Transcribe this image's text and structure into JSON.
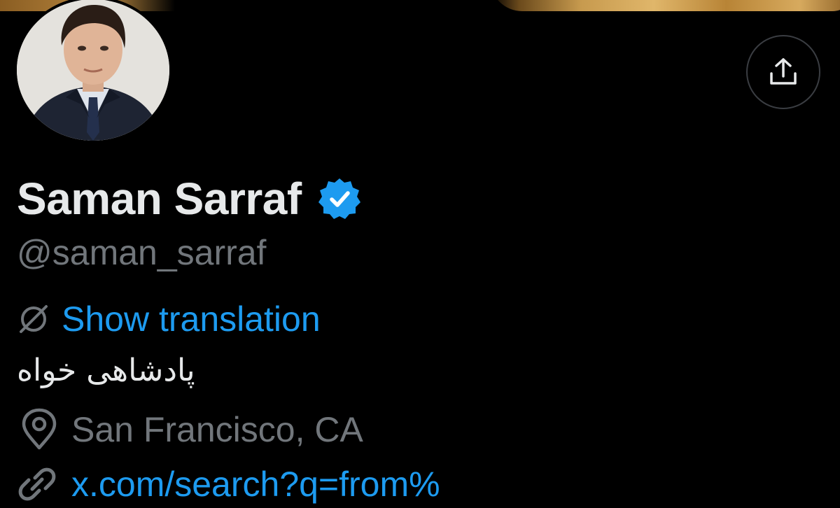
{
  "profile": {
    "display_name": "Saman Sarraf",
    "handle": "@saman_sarraf",
    "verified": true,
    "translate_label": "Show translation",
    "bio": "پادشاهی خواه",
    "location": "San Francisco, CA",
    "website": "x.com/search?q=from%"
  },
  "icons": {
    "share": "share-upload-icon",
    "verified": "verified-badge-icon",
    "translate": "translate-globe-icon",
    "location": "location-pin-icon",
    "link": "link-icon"
  },
  "colors": {
    "background": "#000000",
    "primary_text": "#e7e9ea",
    "secondary_text": "#71767b",
    "accent": "#1d9bf0",
    "border": "#3a3d42"
  }
}
